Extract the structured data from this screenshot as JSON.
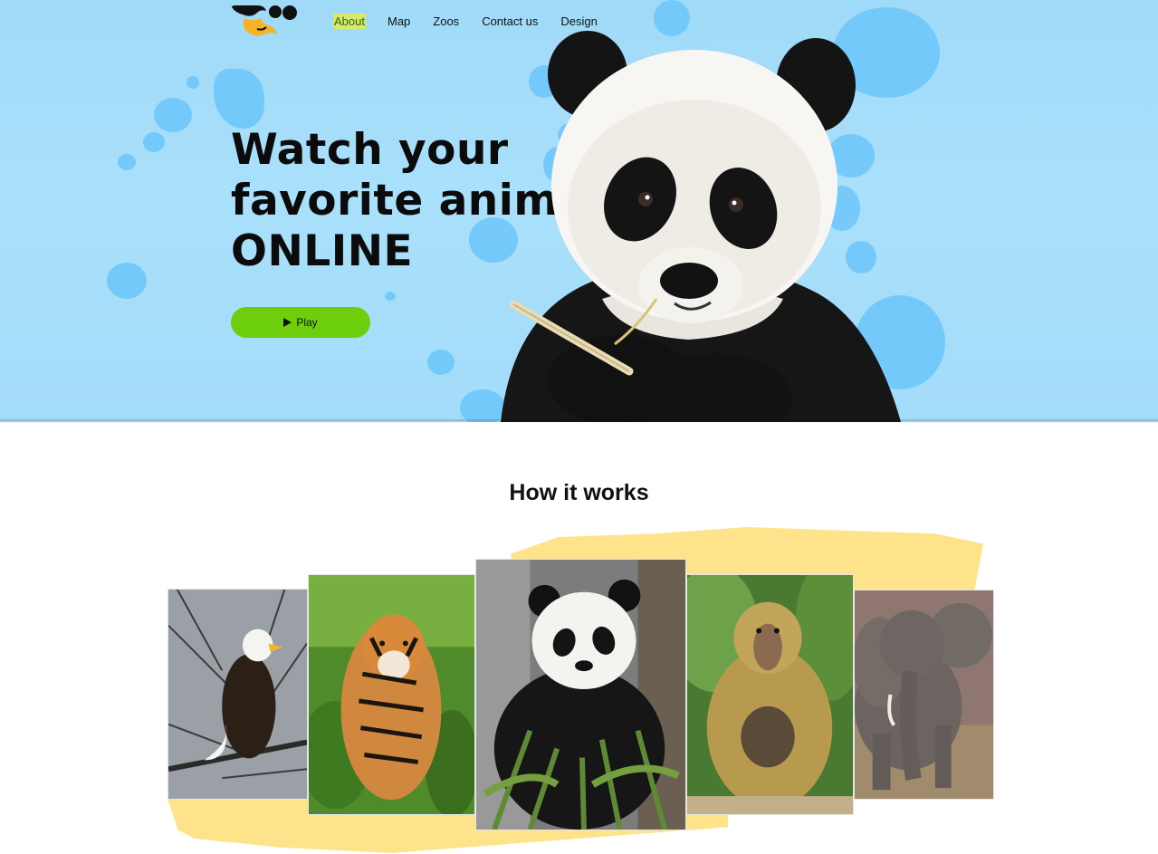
{
  "nav": {
    "items": [
      {
        "label": "About",
        "active": true
      },
      {
        "label": "Map",
        "active": false
      },
      {
        "label": "Zoos",
        "active": false
      },
      {
        "label": "Contact us",
        "active": false
      },
      {
        "label": "Design",
        "active": false
      }
    ]
  },
  "hero": {
    "title_lines": [
      "Watch your",
      "favorite animal",
      "ONLINE"
    ],
    "play_label": "Play",
    "play_icon": "play-icon",
    "image": "panda-eating-bamboo"
  },
  "how_it_works": {
    "title": "How it works",
    "animals": [
      "eagle",
      "tiger",
      "panda",
      "baboon",
      "elephant"
    ]
  },
  "colors": {
    "hero_bg": "#a9e0fb",
    "accent_green": "#6cce0c",
    "paint_yellow": "#ffe38a",
    "logo_orange": "#f5b428"
  }
}
